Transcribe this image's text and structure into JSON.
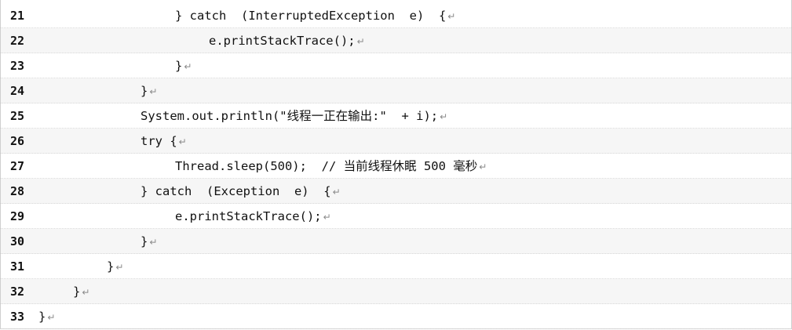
{
  "code_lines": [
    {
      "number": "21",
      "text": "} catch  (InterruptedException  e)  {",
      "indent": 5
    },
    {
      "number": "22",
      "text": "e.printStackTrace();",
      "indent": 6
    },
    {
      "number": "23",
      "text": "}",
      "indent": 5
    },
    {
      "number": "24",
      "text": "}",
      "indent": 4
    },
    {
      "number": "25",
      "text": "System.out.println(\"线程一正在输出:\"  + i);",
      "indent": 4
    },
    {
      "number": "26",
      "text": "try {",
      "indent": 4
    },
    {
      "number": "27",
      "text": "Thread.sleep(500);  // 当前线程休眠 500 毫秒",
      "indent": 5
    },
    {
      "number": "28",
      "text": "} catch  (Exception  e)  {",
      "indent": 4
    },
    {
      "number": "29",
      "text": "e.printStackTrace();",
      "indent": 5
    },
    {
      "number": "30",
      "text": "}",
      "indent": 4
    },
    {
      "number": "31",
      "text": "}",
      "indent": 3
    },
    {
      "number": "32",
      "text": "}",
      "indent": 2
    },
    {
      "number": "33",
      "text": "}",
      "indent": 1
    }
  ],
  "return_mark_icon": "carriage-return-icon"
}
